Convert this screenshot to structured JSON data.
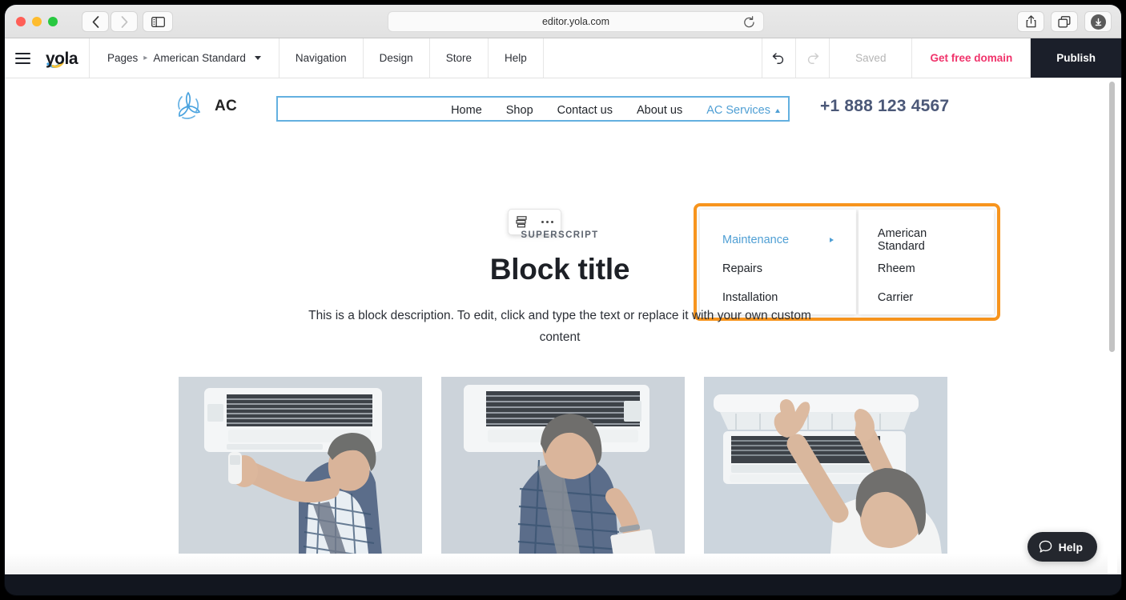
{
  "browser": {
    "url": "editor.yola.com",
    "traffic_lights": [
      "close",
      "minimize",
      "maximize"
    ],
    "back_icon": "chevron-left-icon",
    "forward_icon": "chevron-right-icon",
    "sidebar_icon": "sidebar-toggle-icon",
    "reload_icon": "reload-icon",
    "share_icon": "share-icon",
    "tabs_icon": "duplicate-tabs-icon",
    "download_icon": "download-icon"
  },
  "toolbar": {
    "menu_icon": "hamburger-menu-icon",
    "logo": "yola",
    "pages_label": "Pages",
    "page_name": "American Standard",
    "navigation_label": "Navigation",
    "design_label": "Design",
    "store_label": "Store",
    "help_label": "Help",
    "undo_icon": "undo-icon",
    "redo_icon": "redo-icon",
    "saved_label": "Saved",
    "get_free_domain_label": "Get free domain",
    "publish_label": "Publish",
    "accent_pink": "#f0336b",
    "publish_bg": "#1b1f2a"
  },
  "site": {
    "brand_icon": "fan-logo-icon",
    "brand_name": "AC",
    "phone": "+1 888 123 4567",
    "nav": [
      {
        "label": "Home",
        "active": false
      },
      {
        "label": "Shop",
        "active": false
      },
      {
        "label": "Contact us",
        "active": false
      },
      {
        "label": "About us",
        "active": false
      },
      {
        "label": "AC Services",
        "active": true
      }
    ],
    "nav_selection_color": "#63b0e0"
  },
  "element_toolbar": {
    "layout_icon": "layout-sections-icon",
    "more_icon": "more-options-icon"
  },
  "dropdown": {
    "highlight_color": "#f7941d",
    "level1": [
      {
        "label": "Maintenance",
        "active": true,
        "has_submenu": true
      },
      {
        "label": "Repairs",
        "active": false,
        "has_submenu": false
      },
      {
        "label": "Installation",
        "active": false,
        "has_submenu": false
      }
    ],
    "level2": [
      {
        "label": "American Standard"
      },
      {
        "label": "Rheem"
      },
      {
        "label": "Carrier"
      }
    ]
  },
  "block": {
    "superscript": "SUPERSCRIPT",
    "title": "Block title",
    "description": "This is a block description. To edit, click and type the text or replace it with your own custom content"
  },
  "gallery": [
    {
      "alt": "technician-with-remote-in-front-of-ac-unit"
    },
    {
      "alt": "technician-with-clipboard-inspecting-ac-unit"
    },
    {
      "alt": "technician-opening-ac-unit-front-panel"
    }
  ],
  "help_widget": {
    "icon": "chat-bubble-icon",
    "label": "Help"
  }
}
